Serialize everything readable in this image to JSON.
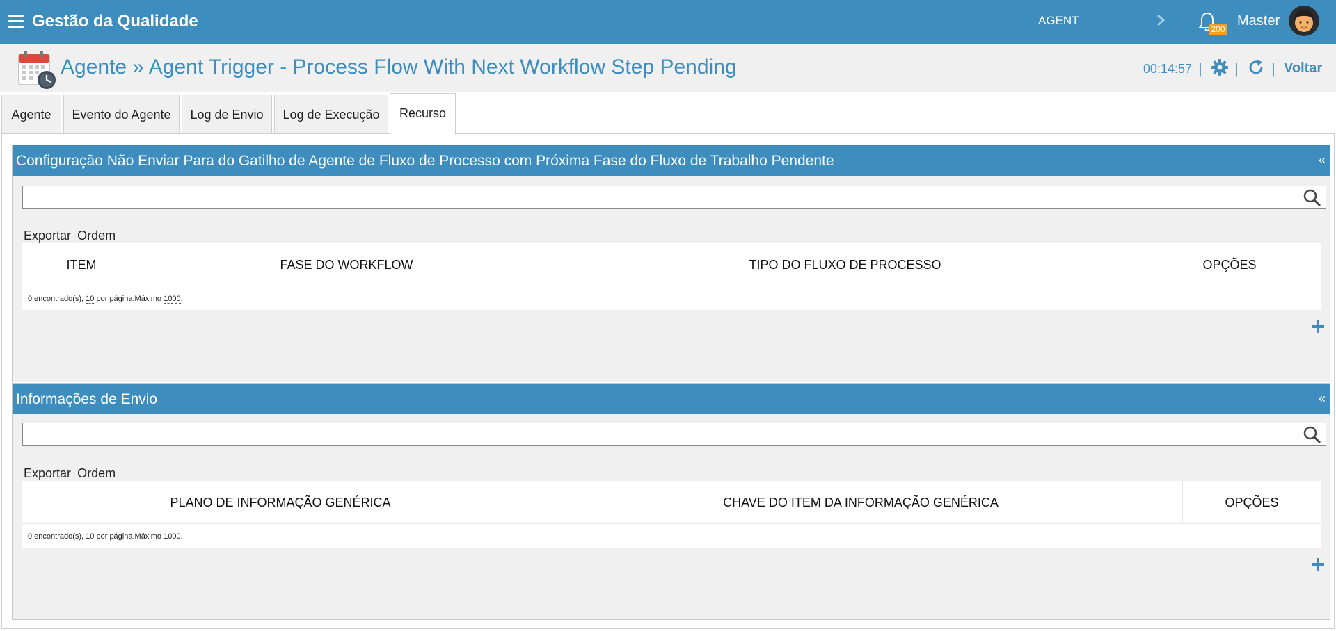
{
  "app": {
    "title": "Gestão da Qualidade"
  },
  "topbar": {
    "search_value": "AGENT",
    "notifications_count": "200",
    "user_name": "Master",
    "icons": [
      "menu-icon",
      "chevron-right-icon",
      "bell-icon",
      "avatar"
    ]
  },
  "header": {
    "title": "Agente » Agent Trigger - Process Flow With Next Workflow Step Pending",
    "timer": "00:14:57",
    "separator": "|",
    "back_label": "Voltar",
    "icons": [
      "calendar-clock-icon",
      "gear-icon",
      "refresh-icon"
    ]
  },
  "tabs": [
    {
      "label": "Agente",
      "active": false
    },
    {
      "label": "Evento do Agente",
      "active": false
    },
    {
      "label": "Log de Envio",
      "active": false
    },
    {
      "label": "Log de Execução",
      "active": false
    },
    {
      "label": "Recurso",
      "active": true
    }
  ],
  "panels": [
    {
      "title": "Configuração Não Enviar Para do Gatilho de Agente de Fluxo de Processo com Próxima Fase do Fluxo de Trabalho Pendente",
      "collapse": "«",
      "search_value": "",
      "toolbar": {
        "export": "Exportar",
        "sep": "|",
        "order": "Ordem"
      },
      "columns": [
        "ITEM",
        "FASE DO WORKFLOW",
        "TIPO DO FLUXO DE PROCESSO",
        "OPÇÕES"
      ],
      "rows": [],
      "footer": {
        "found": "0 encontrado(s),",
        "per_page": "10",
        "per_page_label": "por página.Máximo",
        "max": "1000",
        "end": "."
      }
    },
    {
      "title": "Informações de Envio",
      "collapse": "«",
      "search_value": "",
      "toolbar": {
        "export": "Exportar",
        "sep": "|",
        "order": "Ordem"
      },
      "columns": [
        "PLANO DE INFORMAÇÃO GENÉRICA",
        "CHAVE DO ITEM DA INFORMAÇÃO GENÉRICA",
        "OPÇÕES"
      ],
      "rows": [],
      "footer": {
        "found": "0 encontrado(s),",
        "per_page": "10",
        "per_page_label": "por página.Máximo",
        "max": "1000",
        "end": "."
      }
    }
  ],
  "colors": {
    "primary": "#3d8dbf",
    "badge": "#f0a020",
    "panel_bg": "#f0f0f0"
  }
}
